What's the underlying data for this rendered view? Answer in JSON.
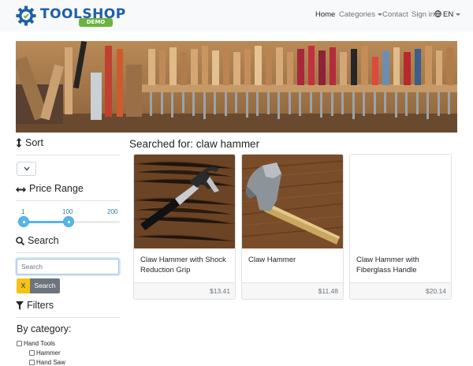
{
  "brand": {
    "name": "TOOLSHOP",
    "badge": "DEMO"
  },
  "nav": {
    "home": "Home",
    "categories": "Categories",
    "contact": "Contact",
    "sign_in": "Sign in",
    "language": "EN"
  },
  "sidebar": {
    "sort_heading": "Sort",
    "sort_selected": "",
    "price_heading": "Price Range",
    "price_min_label": "1",
    "price_max_label": "200",
    "price_handle_low": 1,
    "price_handle_high": 100,
    "price_handle_high_label": "100",
    "search_heading": "Search",
    "search_placeholder": "Search",
    "search_value": "",
    "clear_label": "X",
    "search_button": "Search",
    "filters_heading": "Filters",
    "category_heading": "By category:",
    "categories": [
      {
        "label": "Hand Tools",
        "checked": false,
        "indent": 0
      },
      {
        "label": "Hammer",
        "checked": false,
        "indent": 1
      },
      {
        "label": "Hand Saw",
        "checked": false,
        "indent": 1
      }
    ]
  },
  "results": {
    "title": "Searched for: claw hammer",
    "products": [
      {
        "name": "Claw Hammer with Shock Reduction Grip",
        "price": "$13.41",
        "image": "claw-hammer-shock-grip"
      },
      {
        "name": "Claw Hammer",
        "price": "$11.48",
        "image": "claw-hammer-wood"
      },
      {
        "name": "Claw Hammer with Fiberglass Handle",
        "price": "$20.14",
        "image": "missing"
      }
    ]
  },
  "colors": {
    "brand_blue": "#1e5fa8",
    "demo_green": "#6bb43e",
    "slider_blue": "#58b5e8",
    "clear_yellow": "#f5c218",
    "search_gray": "#6c757d"
  }
}
